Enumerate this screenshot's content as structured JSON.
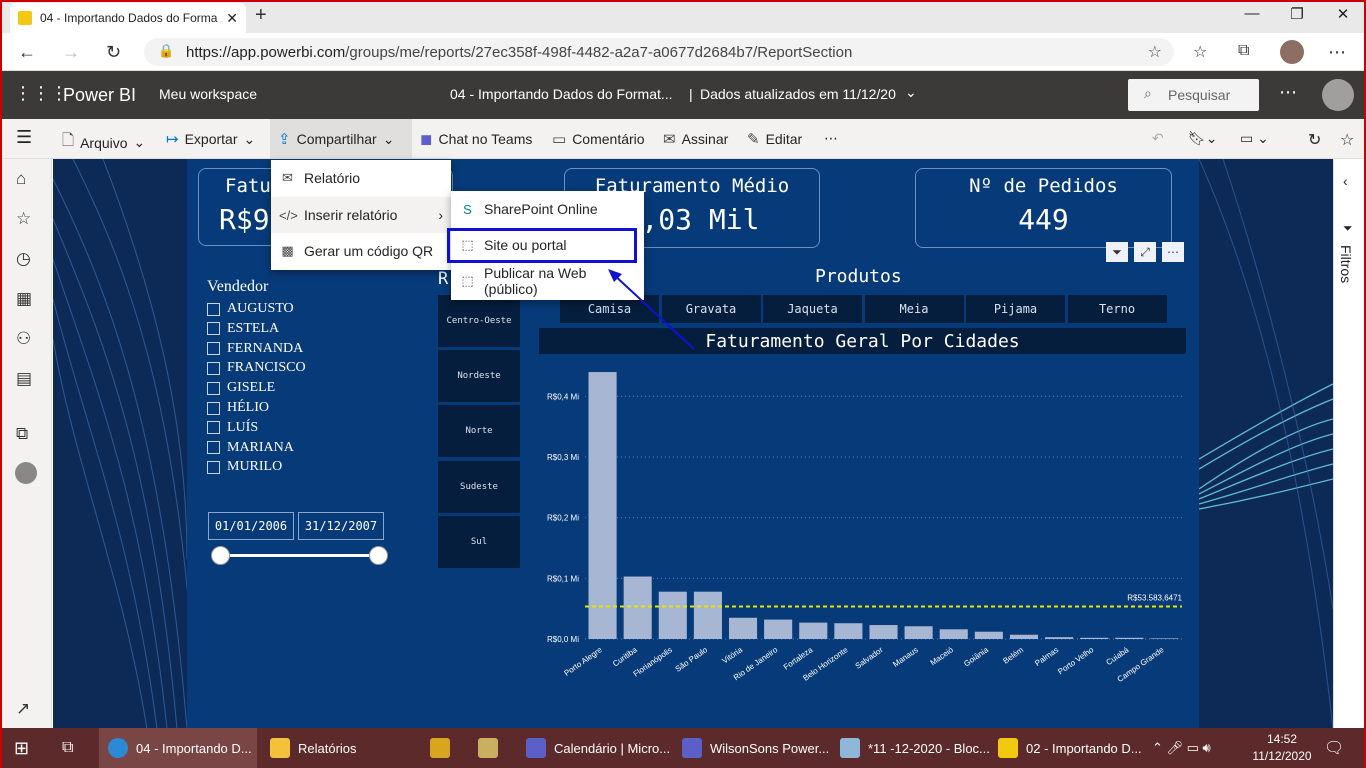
{
  "browser": {
    "tab_title": "04 - Importando Dados do Forma",
    "url_prefix": "https://app.powerbi.com",
    "url_path": "/groups/me/reports/27ec358f-498f-4482-a2a7-a0677d2684b7/ReportSection"
  },
  "pbi": {
    "brand": "Power BI",
    "workspace": "Meu workspace",
    "report_title": "04 - Importando Dados do Format...",
    "updated": "Dados atualizados em 11/12/20",
    "search_placeholder": "Pesquisar"
  },
  "toolbar": {
    "file": "Arquivo",
    "export": "Exportar",
    "share": "Compartilhar",
    "teams": "Chat no Teams",
    "comment": "Comentário",
    "subscribe": "Assinar",
    "edit": "Editar"
  },
  "share_menu": {
    "items": [
      "Relatório",
      "Inserir relatório",
      "Gerar um código QR"
    ]
  },
  "embed_menu": {
    "items": [
      "SharePoint Online",
      "Site ou portal",
      "Publicar na Web (público)"
    ]
  },
  "filters_label": "Filtros",
  "cards": {
    "c1_label": "Fatu",
    "c1_value": "R$9",
    "c2_label": "Faturamento Médio",
    "c2_value": "2,03 Mil",
    "c3_label": "Nº de Pedidos",
    "c3_value": "449"
  },
  "slicer": {
    "title": "Vendedor",
    "names": [
      "AUGUSTO",
      "ESTELA",
      "FERNANDA",
      "FRANCISCO",
      "GISELE",
      "HÉLIO",
      "LUÍS",
      "MARIANA",
      "MURILO"
    ],
    "date_start": "01/01/2006",
    "date_end": "31/12/2007"
  },
  "regions": {
    "title": "R",
    "items": [
      "Centro-Oeste",
      "Nordeste",
      "Norte",
      "Sudeste",
      "Sul"
    ]
  },
  "products": {
    "title": "Produtos",
    "items": [
      "Camisa",
      "Gravata",
      "Jaqueta",
      "Meia",
      "Pijama",
      "Terno"
    ]
  },
  "chart_data": {
    "type": "bar",
    "title": "Faturamento Geral Por Cidades",
    "categories": [
      "Porto Alegre",
      "Curitiba",
      "Florianópolis",
      "São Paulo",
      "Vitória",
      "Rio de Janeiro",
      "Fortaleza",
      "Belo Horizonte",
      "Salvador",
      "Manaus",
      "Maceió",
      "Goiânia",
      "Belém",
      "Palmas",
      "Porto Velho",
      "Cuiabá",
      "Campo Grande"
    ],
    "values": [
      0.44,
      0.103,
      0.078,
      0.078,
      0.035,
      0.032,
      0.027,
      0.026,
      0.023,
      0.021,
      0.016,
      0.012,
      0.007,
      0.003,
      0.002,
      0.002,
      0.001
    ],
    "ylim": [
      0,
      0.45
    ],
    "yticks": [
      "R$0,0 Mi",
      "R$0,1 Mi",
      "R$0,2 Mi",
      "R$0,3 Mi",
      "R$0,4 Mi"
    ],
    "average_value": 0.0536,
    "average_label": "R$53.583,6471",
    "bar_color": "#a7b7d3",
    "average_color": "#e6e600"
  },
  "taskbar": {
    "items": [
      "04 - Importando D...",
      "Relatórios",
      "Calendário | Micro...",
      "WilsonSons Power...",
      "*11 -12-2020 - Bloc...",
      "02 - Importando D..."
    ],
    "time": "14:52",
    "date": "11/12/2020"
  }
}
